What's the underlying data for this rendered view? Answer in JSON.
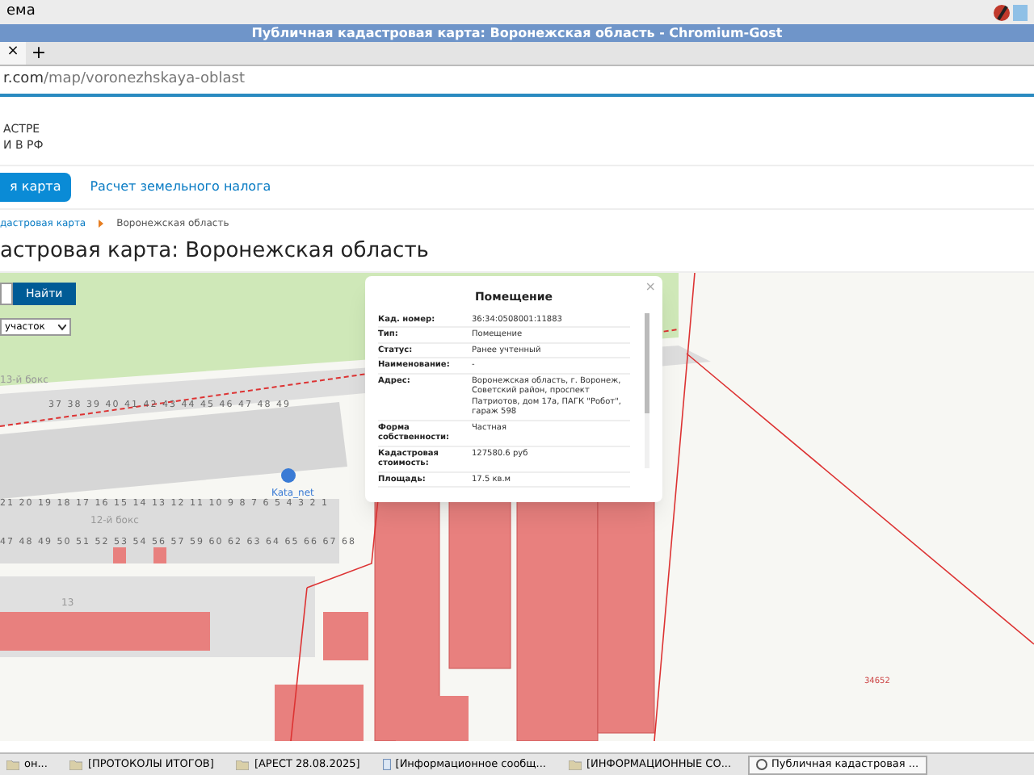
{
  "system_menu": {
    "label": "ема"
  },
  "window": {
    "title": "Публичная кадастровая карта: Воронежская область - Chromium-Gost"
  },
  "browser": {
    "tab_close": "×",
    "new_tab": "+",
    "address": {
      "host": "r.com",
      "path": "/map/voronezhskaya-oblast"
    }
  },
  "site": {
    "logo_lines": [
      "АСТРЕ",
      "И В РФ"
    ],
    "nav": [
      {
        "label": "я карта",
        "selected": true
      },
      {
        "label": "Расчет земельного налога",
        "selected": false
      }
    ],
    "breadcrumbs": [
      "дастровая карта",
      "Воронежская область"
    ],
    "heading": "астровая карта: Воронежская область"
  },
  "map": {
    "search_button": "Найти",
    "type_select": "участок",
    "labels": [
      {
        "text": "13-й бокс",
        "kind": "street"
      },
      {
        "text": "37 38 39 40 41 42 43 44 45 46 47 48 49",
        "kind": "numbers"
      },
      {
        "text": "Kata_net",
        "kind": "poi"
      },
      {
        "text": "21 20 19 18 17 16 15 14 13 12 11 10 9 8 7 6 5 4 3 2 1",
        "kind": "numbers"
      },
      {
        "text": "12-й бокс",
        "kind": "street"
      },
      {
        "text": "47 48 49 50 51 52 53 54 56 57 59 60 62 63 64 65 66 67 68",
        "kind": "numbers"
      },
      {
        "text": "13",
        "kind": "street"
      },
      {
        "text": "34652",
        "kind": "parcel"
      }
    ],
    "popup": {
      "title": "Помещение",
      "close": "×",
      "rows": [
        {
          "label": "Кад. номер:",
          "value": "36:34:0508001:11883"
        },
        {
          "label": "Тип:",
          "value": "Помещение"
        },
        {
          "label": "Статус:",
          "value": "Ранее учтенный"
        },
        {
          "label": "Наименование:",
          "value": "-"
        },
        {
          "label": "Адрес:",
          "value": "Воронежская область, г. Воронеж, Советский район, проспект Патриотов, дом 17а, ПАГК \"Робот\", гараж 598"
        },
        {
          "label": "Форма собственности:",
          "value": "Частная"
        },
        {
          "label": "Кадастровая стоимость:",
          "value": "127580.6 руб"
        },
        {
          "label": "Площадь:",
          "value": "17.5 кв.м"
        }
      ]
    }
  },
  "taskbar": [
    {
      "label": "он...",
      "kind": "folder",
      "selected": false
    },
    {
      "label": "[ПРОТОКОЛЫ ИТОГОВ]",
      "kind": "folder",
      "selected": false
    },
    {
      "label": "[АРЕСТ 28.08.2025]",
      "kind": "folder",
      "selected": false
    },
    {
      "label": "[Информационное сообщ...",
      "kind": "doc",
      "selected": false
    },
    {
      "label": "[ИНФОРМАЦИОННЫЕ СО...",
      "kind": "folder",
      "selected": false
    },
    {
      "label": "Публичная кадастровая ...",
      "kind": "browser",
      "selected": true
    }
  ]
}
